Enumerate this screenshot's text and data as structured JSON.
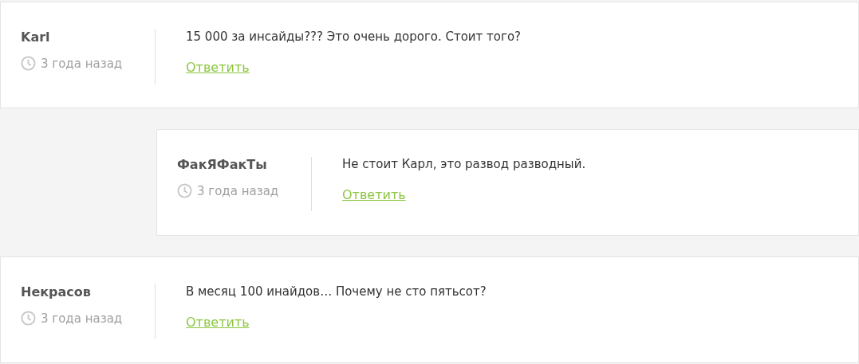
{
  "comments": [
    {
      "author": "Karl",
      "time": "3 года назад",
      "text": "15 000 за инсайды??? Это очень дорого. Стоит того?",
      "reply": "Ответить",
      "children": [
        {
          "author": "ФакЯФакТы",
          "time": "3 года назад",
          "text": "Не стоит Карл, это развод разводный.",
          "reply": "Ответить"
        }
      ]
    },
    {
      "author": "Некрасов",
      "time": "3 года назад",
      "text": "В месяц 100 инайдов… Почему не сто пятьсот?",
      "reply": "Ответить"
    }
  ]
}
